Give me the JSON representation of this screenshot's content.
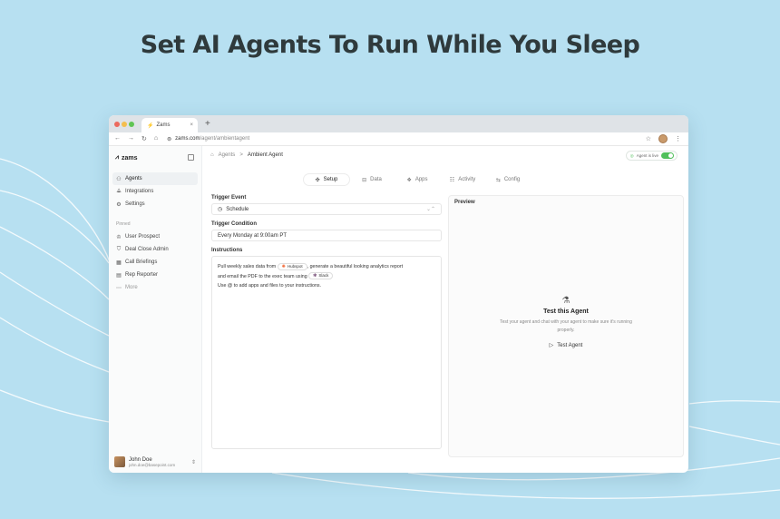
{
  "headline": "Set AI Agents To Run While You Sleep",
  "browser": {
    "tab_title": "Zams",
    "tab_close": "×",
    "new_tab": "+",
    "url_host": "zams.com",
    "url_path": "/agent/ambientagent",
    "nav": {
      "back": "←",
      "forward": "→",
      "reload": "↻",
      "home": "⌂"
    }
  },
  "sidebar": {
    "brand": "zams",
    "items": [
      {
        "label": "Agents",
        "icon": "bot-icon",
        "glyph": "⚇",
        "active": true
      },
      {
        "label": "Integrations",
        "icon": "integrations-icon",
        "glyph": "⟁"
      },
      {
        "label": "Settings",
        "icon": "gear-icon",
        "glyph": "⚙"
      }
    ],
    "pinned_label": "Pinned",
    "pinned": [
      {
        "label": "User Prospect",
        "icon": "trophy-icon",
        "glyph": "♔"
      },
      {
        "label": "Deal Close Admin",
        "icon": "badge-icon",
        "glyph": "⛉"
      },
      {
        "label": "Call Briefings",
        "icon": "calendar-icon",
        "glyph": "▦"
      },
      {
        "label": "Rep Reporter",
        "icon": "document-icon",
        "glyph": "▤"
      }
    ],
    "more": "More",
    "user": {
      "name": "John Doe",
      "email": "john.doe@basepoint.com"
    }
  },
  "main": {
    "breadcrumb": {
      "root": "Agents",
      "separator": ">",
      "current": "Ambient Agent"
    },
    "live_label": "Agent is live",
    "tabs": [
      {
        "label": "Setup",
        "icon": "setup-icon",
        "glyph": "✣",
        "active": true
      },
      {
        "label": "Data",
        "icon": "database-icon",
        "glyph": "⊟"
      },
      {
        "label": "Apps",
        "icon": "apps-icon",
        "glyph": "❖"
      },
      {
        "label": "Activity",
        "icon": "activity-icon",
        "glyph": "☷"
      },
      {
        "label": "Config",
        "icon": "config-icon",
        "glyph": "⇆"
      }
    ],
    "trigger_event_label": "Trigger Event",
    "trigger_event_value": "Schedule",
    "trigger_condition_label": "Trigger Condition",
    "trigger_condition_value": "Every Monday at 9:00am PT",
    "instructions_label": "Instructions",
    "instructions": {
      "part1": "Pull weekly sales data from",
      "chip1": "Hubspot",
      "part2": ", generate a beautiful looking analytics report",
      "part3": "and email the PDF to the exec team using",
      "chip2": "Slack",
      "line3": "Use @ to add apps and files to your instructions."
    }
  },
  "preview": {
    "title": "Preview",
    "heading": "Test this Agent",
    "sub": "Test your agent and chat with your agent to make sure it's running properly.",
    "button": "Test Agent"
  },
  "colors": {
    "background": "#b7e0f1",
    "toggle_on": "#4fbf5a",
    "hubspot": "#f26b3a"
  }
}
